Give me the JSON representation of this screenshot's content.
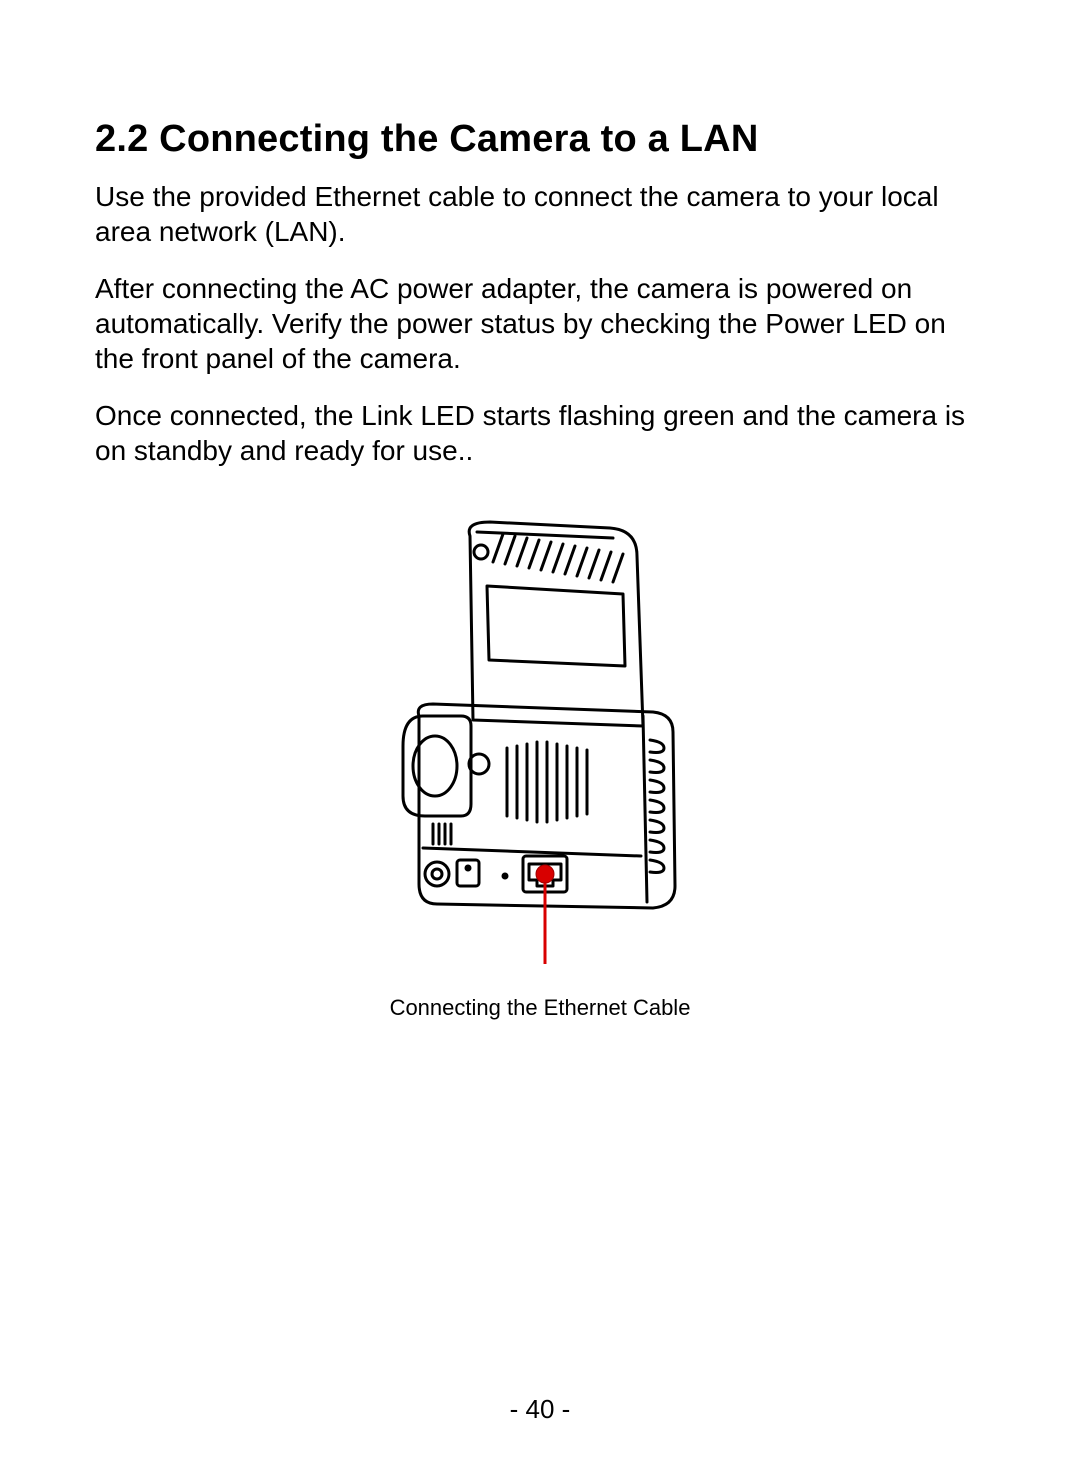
{
  "heading": "2.2  Connecting the Camera to a LAN",
  "paragraphs": {
    "p1": "Use the provided Ethernet cable to connect the camera to your local area network (LAN).",
    "p2": "After connecting the AC power adapter, the camera is powered on automatically. Verify the power status by checking the Power LED on the front panel of the camera.",
    "p3": "Once connected, the Link LED starts flashing green and the camera is on standby and ready for use.."
  },
  "figure": {
    "caption": "Connecting the Ethernet Cable",
    "alt": "Line drawing of the back of a network camera with a red dot and line marking the Ethernet port."
  },
  "pageNumber": "- 40 -"
}
